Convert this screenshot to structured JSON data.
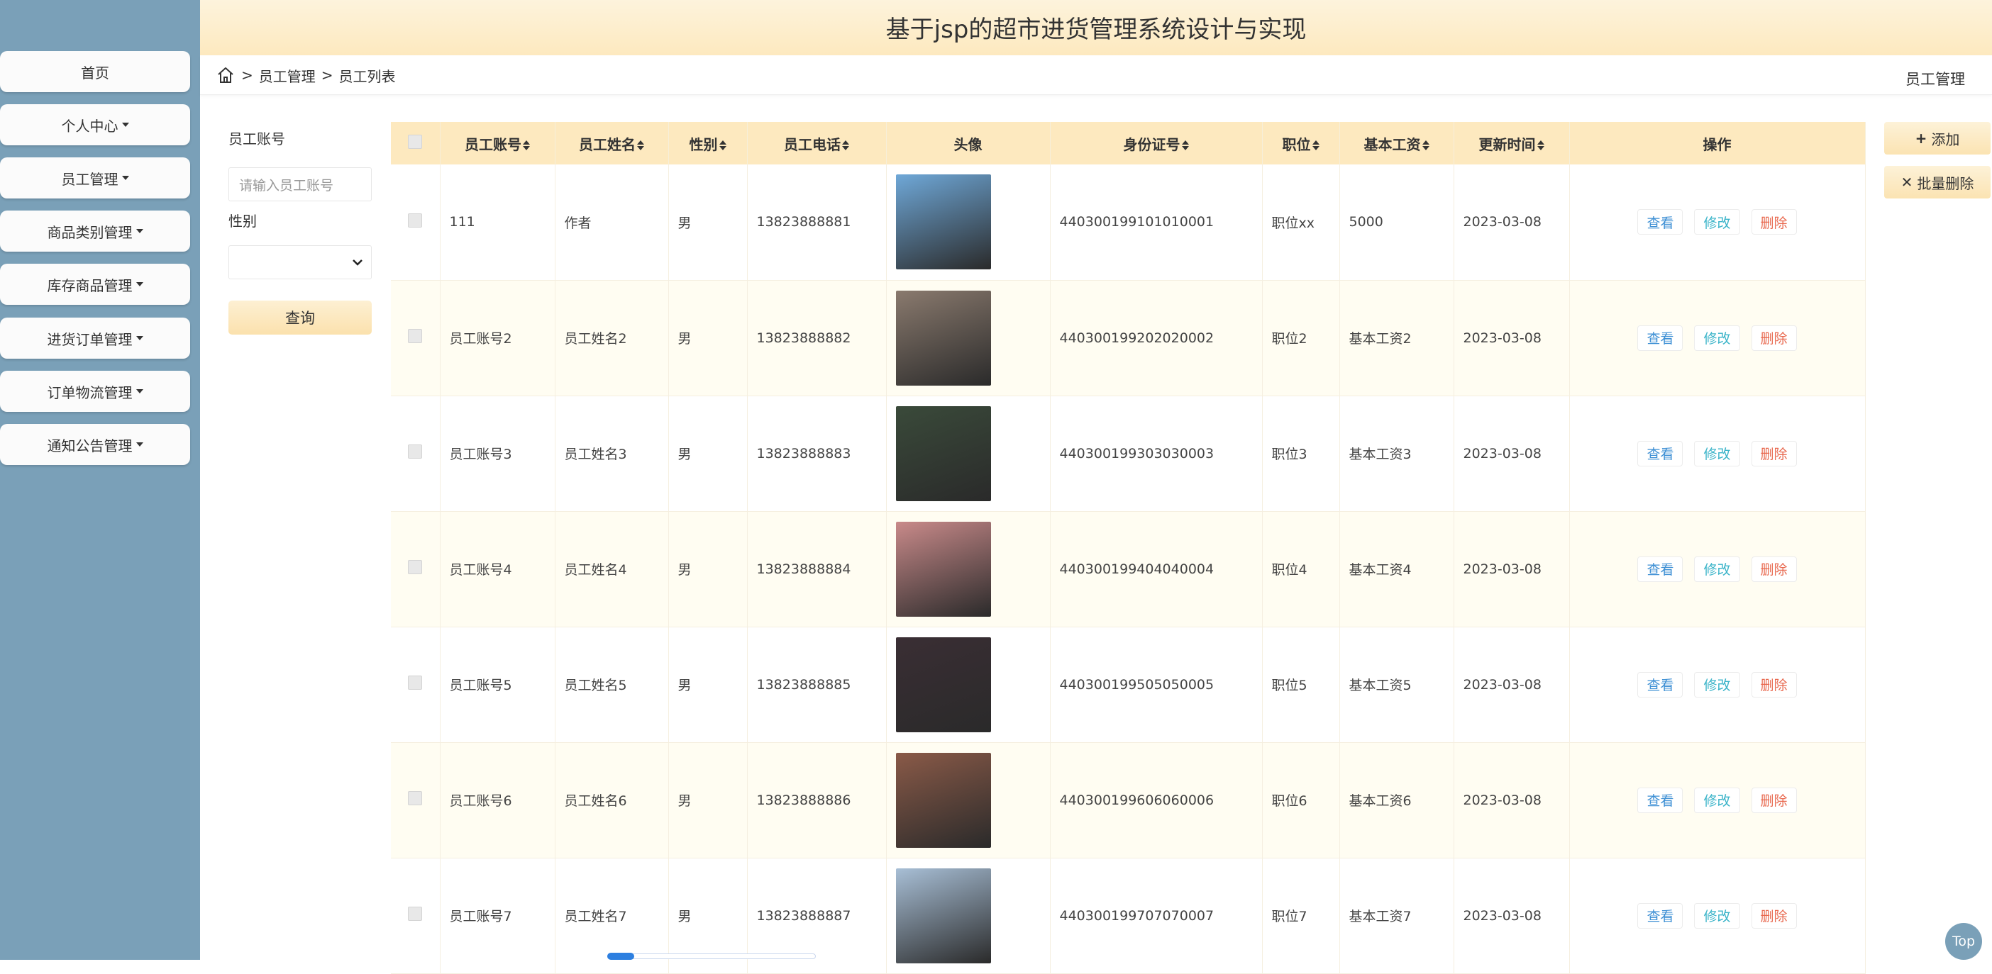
{
  "app": {
    "title": "基于jsp的超市进货管理系统设计与实现"
  },
  "sidebar": {
    "items": [
      {
        "label": "首页",
        "has_caret": false
      },
      {
        "label": "个人中心",
        "has_caret": true
      },
      {
        "label": "员工管理",
        "has_caret": true
      },
      {
        "label": "商品类别管理",
        "has_caret": true
      },
      {
        "label": "库存商品管理",
        "has_caret": true
      },
      {
        "label": "进货订单管理",
        "has_caret": true
      },
      {
        "label": "订单物流管理",
        "has_caret": true
      },
      {
        "label": "通知公告管理",
        "has_caret": true
      }
    ]
  },
  "breadcrumb": {
    "items": [
      "员工管理",
      "员工列表"
    ],
    "current_section": "员工管理"
  },
  "search": {
    "account_label": "员工账号",
    "account_placeholder": "请输入员工账号",
    "gender_label": "性别",
    "gender_value": "",
    "query_button": "查询"
  },
  "actions": {
    "add": "添加",
    "batch_delete": "批量删除"
  },
  "table": {
    "columns": [
      "员工账号",
      "员工姓名",
      "性别",
      "员工电话",
      "头像",
      "身份证号",
      "职位",
      "基本工资",
      "更新时间",
      "操作"
    ],
    "row_actions": {
      "view": "查看",
      "edit": "修改",
      "delete": "删除"
    },
    "rows": [
      {
        "account": "111",
        "name": "作者",
        "gender": "男",
        "phone": "13823888881",
        "id_no": "440300199101010001",
        "position": "职位xx",
        "salary": "5000",
        "updated": "2023-03-08"
      },
      {
        "account": "员工账号2",
        "name": "员工姓名2",
        "gender": "男",
        "phone": "13823888882",
        "id_no": "440300199202020002",
        "position": "职位2",
        "salary": "基本工资2",
        "updated": "2023-03-08"
      },
      {
        "account": "员工账号3",
        "name": "员工姓名3",
        "gender": "男",
        "phone": "13823888883",
        "id_no": "440300199303030003",
        "position": "职位3",
        "salary": "基本工资3",
        "updated": "2023-03-08"
      },
      {
        "account": "员工账号4",
        "name": "员工姓名4",
        "gender": "男",
        "phone": "13823888884",
        "id_no": "440300199404040004",
        "position": "职位4",
        "salary": "基本工资4",
        "updated": "2023-03-08"
      },
      {
        "account": "员工账号5",
        "name": "员工姓名5",
        "gender": "男",
        "phone": "13823888885",
        "id_no": "440300199505050005",
        "position": "职位5",
        "salary": "基本工资5",
        "updated": "2023-03-08"
      },
      {
        "account": "员工账号6",
        "name": "员工姓名6",
        "gender": "男",
        "phone": "13823888886",
        "id_no": "440300199606060006",
        "position": "职位6",
        "salary": "基本工资6",
        "updated": "2023-03-08"
      },
      {
        "account": "员工账号7",
        "name": "员工姓名7",
        "gender": "男",
        "phone": "13823888887",
        "id_no": "440300199707070007",
        "position": "职位7",
        "salary": "基本工资7",
        "updated": "2023-03-08"
      }
    ]
  },
  "avatar_colors": [
    "#6fa8d8",
    "#8a7a6e",
    "#3a4a3a",
    "#c98a8a",
    "#3a2e34",
    "#8a5a48",
    "#a8bfd6"
  ],
  "top_button": "Top",
  "colors": {
    "sidebar_bg": "#7aa0b8",
    "header_bg": "#fde9bf",
    "view": "#3d8fd4",
    "edit": "#3bb4c9",
    "delete": "#e8674d"
  }
}
